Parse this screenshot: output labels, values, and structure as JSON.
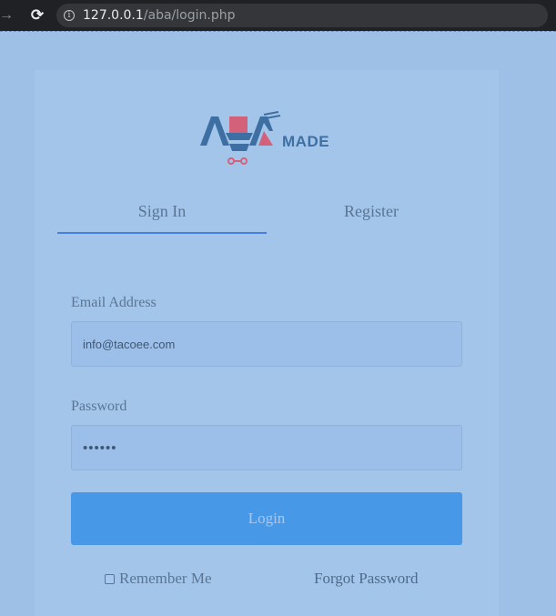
{
  "browser": {
    "url_host": "127.0.0.1",
    "url_path": "/aba/login.php"
  },
  "logo": {
    "text": "ABA MADE",
    "colors": {
      "blue": "#3e6fa3",
      "red": "#d4617a"
    }
  },
  "tabs": [
    {
      "label": "Sign In",
      "active": true
    },
    {
      "label": "Register",
      "active": false
    }
  ],
  "form": {
    "email_label": "Email Address",
    "email_value": "info@tacoee.com",
    "password_label": "Password",
    "password_value": "••••••",
    "login_label": "Login",
    "remember_label": "Remember Me",
    "forgot_label": "Forgot Password"
  },
  "colors": {
    "background": "#9fc0e6",
    "accent": "#4898e8",
    "tab_underline": "#4a7de0"
  }
}
